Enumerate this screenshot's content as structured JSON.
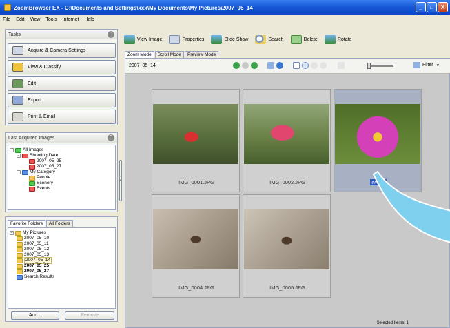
{
  "window": {
    "title": "ZoomBrowser EX  -  C:\\Documents and Settings\\xxx\\My Documents\\My Pictures\\2007_05_14",
    "controls": [
      "_",
      "□",
      "X"
    ]
  },
  "menu": [
    "File",
    "Edit",
    "View",
    "Tools",
    "Internet",
    "Help"
  ],
  "tasks": {
    "header": "Tasks",
    "buttons": [
      "Acquire & Camera Settings",
      "View & Classify",
      "Edit",
      "Export",
      "Print & Email"
    ]
  },
  "last_acquired": {
    "header": "Last Acquired Images",
    "root": "All Images",
    "shooting_date": "Shooting Date",
    "dates": [
      "2007_05_25",
      "2007_05_27"
    ],
    "category": "My Category",
    "categories": [
      "People",
      "Scenery",
      "Events"
    ]
  },
  "folders": {
    "tabs": [
      "Favorite Folders",
      "All Folders"
    ],
    "root": "My Pictures",
    "items": [
      "2007_05_10",
      "2007_05_11",
      "2007_05_12",
      "2007_05_13",
      "2007_05_14"
    ],
    "bold_items": [
      "2007_05_25",
      "2007_05_27"
    ],
    "search_results": "Search Results",
    "add_label": "Add...",
    "remove_label": "Remove"
  },
  "toolbar": [
    "View Image",
    "Properties",
    "Slide Show",
    "Search",
    "Delete",
    "Rotate"
  ],
  "view_tabs": [
    "Zoom Mode",
    "Scroll Mode",
    "Preview Mode"
  ],
  "content": {
    "path": "2007_05_14",
    "filter_label": "Filter",
    "thumbnails": [
      "IMG_0001.JPG",
      "IMG_0002.JPG",
      "IMG_0003.JPG",
      "IMG_0004.JPG",
      "IMG_0005.JPG"
    ],
    "selected_caption": "IMG_0"
  },
  "status": {
    "selected_items": "Selected Items: 1"
  }
}
